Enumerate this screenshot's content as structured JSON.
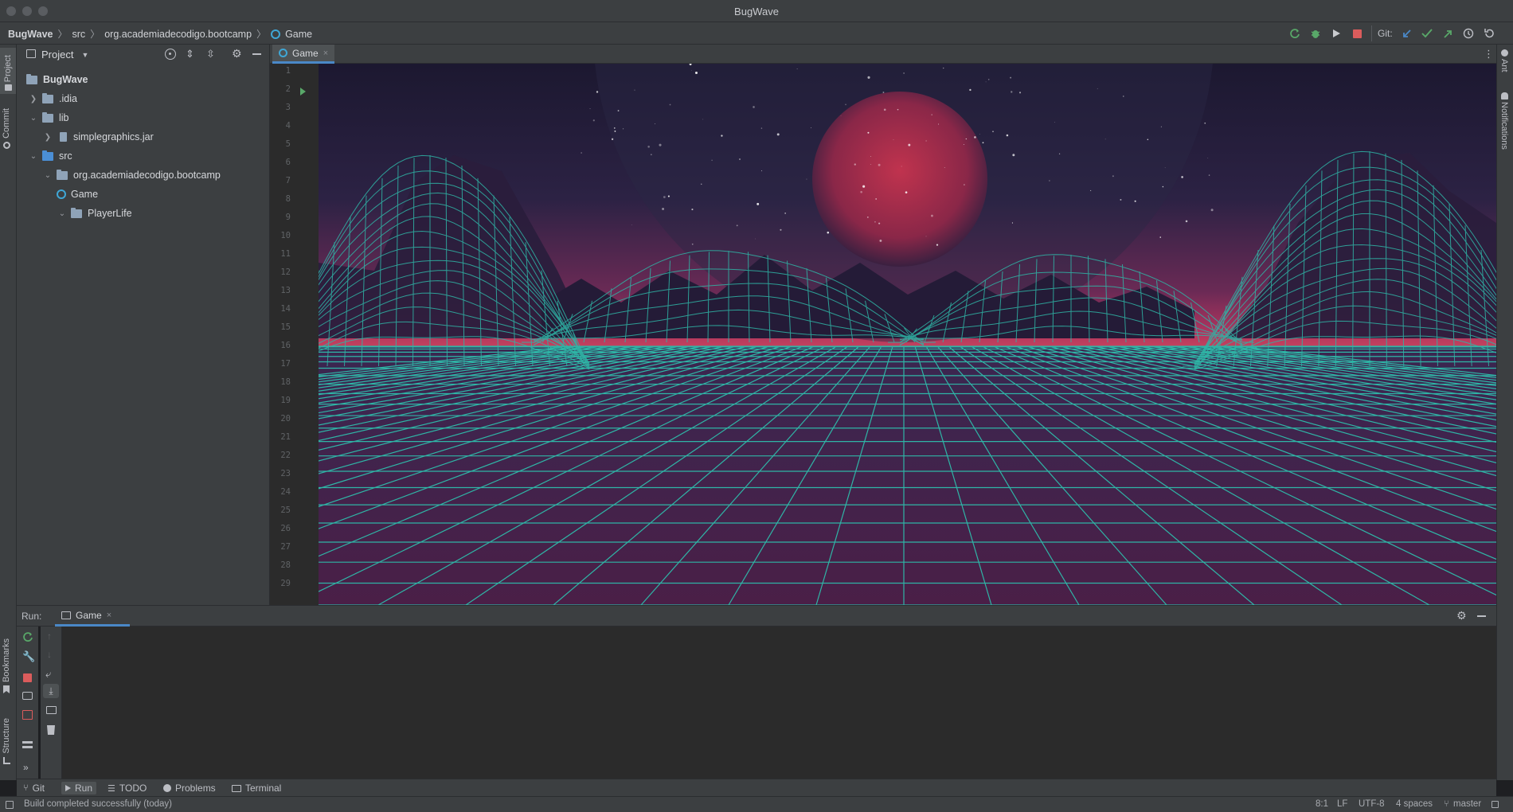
{
  "window": {
    "title": "BugWave"
  },
  "breadcrumb": {
    "project": "BugWave",
    "folder": "src",
    "package": "org.academiadecodigo.bootcamp",
    "file": "Game"
  },
  "toolbar": {
    "git_label": "Git:"
  },
  "left_strip": {
    "project": "Project",
    "commit": "Commit",
    "bookmarks": "Bookmarks",
    "structure": "Structure"
  },
  "right_strip": {
    "ant": "Ant",
    "notifications": "Notifications"
  },
  "project_panel": {
    "title": "Project",
    "tree": [
      {
        "label": "BugWave",
        "icon": "project-folder-icon",
        "expanded": true
      },
      {
        "label": ".idia",
        "icon": "folder-icon",
        "expanded": false
      },
      {
        "label": "lib",
        "icon": "folder-icon",
        "expanded": true
      },
      {
        "label": "simplegraphics.jar",
        "icon": "jar-icon",
        "expanded": false
      },
      {
        "label": "src",
        "icon": "source-folder-icon",
        "expanded": true
      },
      {
        "label": "org.academiadecodigo.bootcamp",
        "icon": "package-icon",
        "expanded": true
      },
      {
        "label": "Game",
        "icon": "java-class-icon"
      },
      {
        "label": "PlayerLife",
        "icon": "package-icon",
        "expanded": true
      }
    ]
  },
  "editor": {
    "tab": "Game",
    "line_numbers": [
      "1",
      "2",
      "3",
      "4",
      "5",
      "6",
      "7",
      "8",
      "9",
      "10",
      "11",
      "12",
      "13",
      "14",
      "15",
      "16",
      "17",
      "18",
      "19",
      "20",
      "21",
      "22",
      "23",
      "24",
      "25",
      "26",
      "27",
      "28",
      "29"
    ]
  },
  "run_panel": {
    "label": "Run:",
    "tab": "Game"
  },
  "bottom_tools": {
    "git": "Git",
    "run": "Run",
    "todo": "TODO",
    "problems": "Problems",
    "terminal": "Terminal"
  },
  "status": {
    "message": "Build completed successfully (today)",
    "position": "8:1",
    "line_ending": "LF",
    "encoding": "UTF-8",
    "indent": "4 spaces",
    "branch": "master"
  },
  "colors": {
    "accent": "#4a88c7",
    "run_green": "#59a869",
    "stop_red": "#db5c5c",
    "grid_cyan": "#2fb5a6",
    "sky_magenta": "#c23a6c"
  }
}
